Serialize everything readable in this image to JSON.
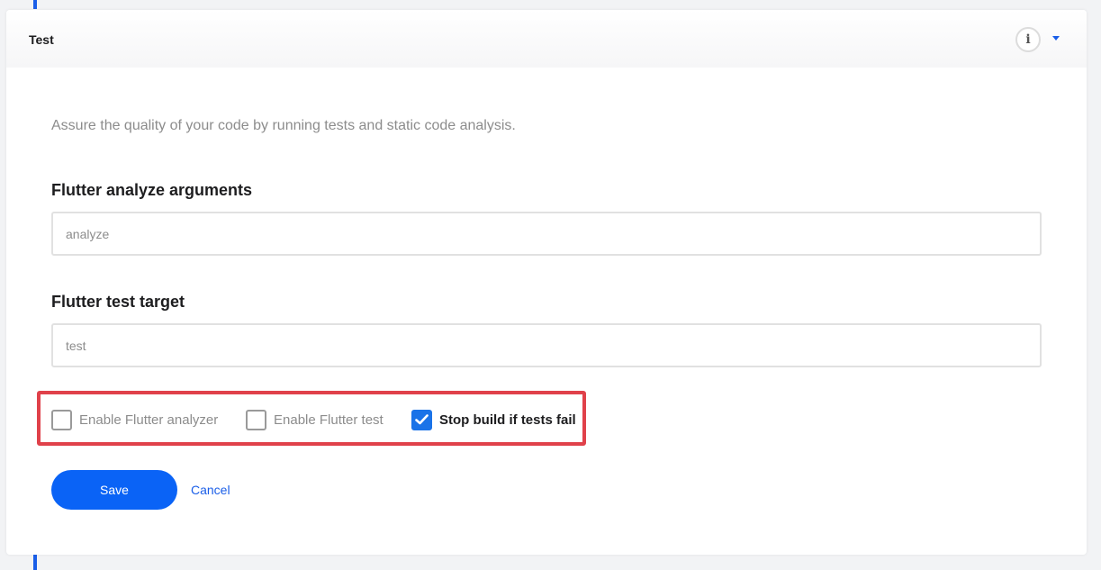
{
  "card": {
    "title": "Test",
    "description": "Assure the quality of your code by running tests and static code analysis.",
    "info_icon": "i",
    "toggle_icon": "caret-down-icon"
  },
  "fields": {
    "analyze": {
      "label": "Flutter analyze arguments",
      "value": "analyze"
    },
    "test_target": {
      "label": "Flutter test target",
      "value": "test"
    }
  },
  "checkboxes": {
    "enable_analyzer": {
      "label": "Enable Flutter analyzer",
      "checked": false
    },
    "enable_test": {
      "label": "Enable Flutter test",
      "checked": false
    },
    "stop_build": {
      "label": "Stop build if tests fail",
      "checked": true
    }
  },
  "actions": {
    "save": "Save",
    "cancel": "Cancel"
  },
  "colors": {
    "accent": "#0a63f6",
    "highlight": "#e0414a"
  }
}
